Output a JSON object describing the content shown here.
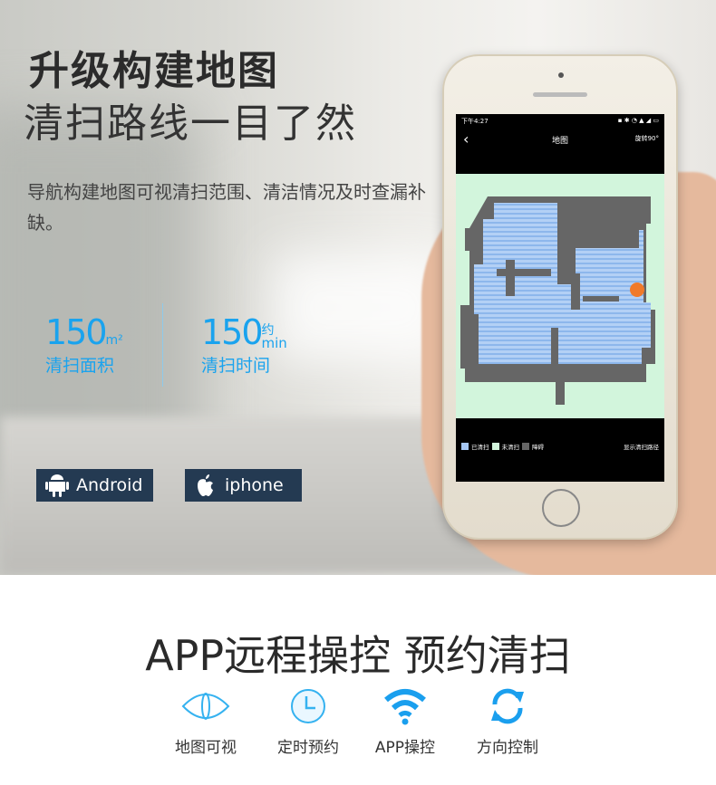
{
  "headline": "升级构建地图",
  "subheadline": "清扫路线一目了然",
  "description": "导航构建地图可视清扫范围、清洁情况及时查漏补缺。",
  "stats": [
    {
      "value": "150",
      "unit": "m²",
      "extra": "",
      "label": "清扫面积"
    },
    {
      "value": "150",
      "unit": "min",
      "extra": "约",
      "label": "清扫时间"
    }
  ],
  "platforms": [
    {
      "label": "Android",
      "icon": "android-icon"
    },
    {
      "label": "iphone",
      "icon": "apple-icon"
    }
  ],
  "phone": {
    "time": "下午4:27",
    "title": "地图",
    "back": "‹",
    "rotate": "旋转90°",
    "legend": [
      {
        "label": "已清扫",
        "color": "#a6c8f5"
      },
      {
        "label": "未清扫",
        "color": "#d2f5dc"
      },
      {
        "label": "障碍",
        "color": "#666666"
      }
    ],
    "show_path": "显示清扫路径"
  },
  "bottom_title": "APP远程操控 预约清扫",
  "features": [
    {
      "label": "地图可视",
      "icon": "eye-icon"
    },
    {
      "label": "定时预约",
      "icon": "clock-icon"
    },
    {
      "label": "APP操控",
      "icon": "wifi-icon"
    },
    {
      "label": "方向控制",
      "icon": "refresh-icon"
    }
  ],
  "colors": {
    "accent": "#1aa3ee",
    "badge": "#243a52"
  }
}
